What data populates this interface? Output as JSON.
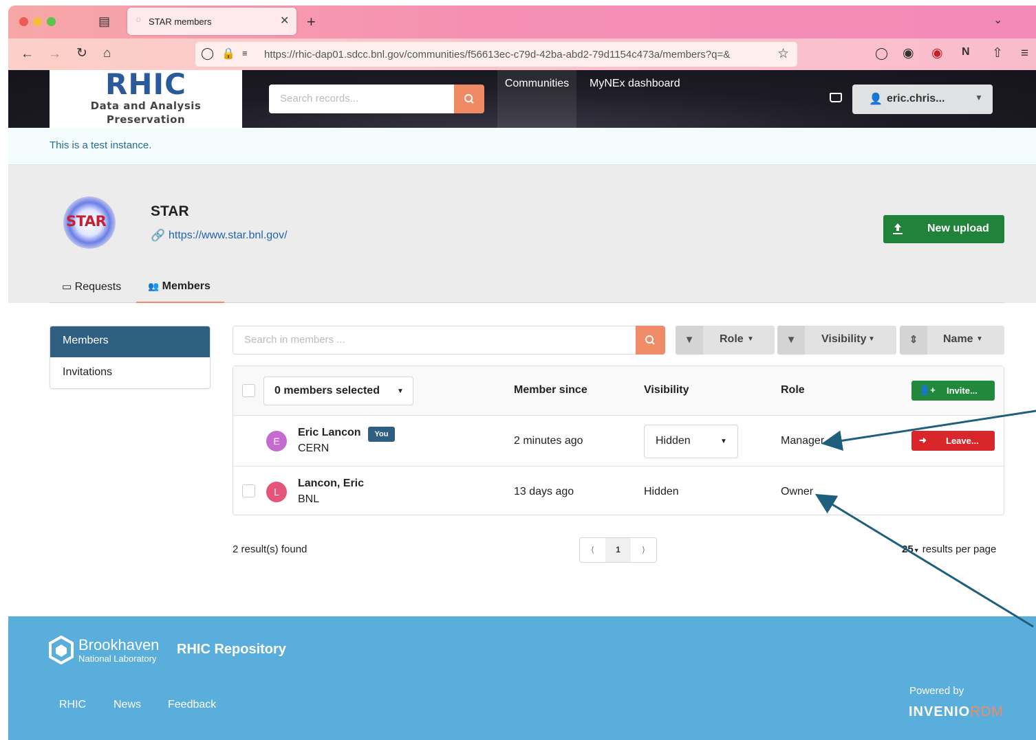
{
  "browser": {
    "tab_title": "STAR members",
    "url": "https://rhic-dap01.sdcc.bnl.gov/communities/f56613ec-c79d-42ba-abd2-79d1154c473a/members?q=&"
  },
  "site": {
    "logo_title": "RHIC",
    "logo_line1": "Data and Analysis",
    "logo_line2": "Preservation",
    "search_placeholder": "Search records...",
    "nav_communities": "Communities",
    "nav_mynex": "MyNEx dashboard",
    "user_label": "eric.chris..."
  },
  "banner": "This is a test instance.",
  "community": {
    "logo_text": "STAR",
    "title": "STAR",
    "link": "https://www.star.bnl.gov/",
    "new_upload": "New upload",
    "tabs": [
      {
        "label": "Requests",
        "active": false
      },
      {
        "label": "Members",
        "active": true
      }
    ]
  },
  "sidebar": {
    "items": [
      {
        "label": "Members",
        "active": true
      },
      {
        "label": "Invitations",
        "active": false
      }
    ]
  },
  "members_search": {
    "placeholder": "Search in members ..."
  },
  "filters": {
    "role": "Role",
    "visibility": "Visibility",
    "sort": "Name"
  },
  "table": {
    "selected": "0 members selected",
    "headers": {
      "since": "Member since",
      "visibility": "Visibility",
      "role": "Role"
    },
    "invite": "Invite...",
    "rows": [
      {
        "initial": "E",
        "name": "Eric Lancon",
        "you": "You",
        "org": "CERN",
        "since": "2 minutes ago",
        "visibility": "Hidden",
        "role": "Manager",
        "action": "Leave...",
        "avatar_color": "#c56bd0"
      },
      {
        "initial": "L",
        "name": "Lancon, Eric",
        "org": "BNL",
        "since": "13 days ago",
        "visibility": "Hidden",
        "role": "Owner",
        "avatar_color": "#e5557a"
      }
    ]
  },
  "results": {
    "found": "2 result(s) found",
    "page": "1",
    "per_page": "25",
    "per_page_label": "results per page"
  },
  "footer": {
    "org_name": "Brookhaven",
    "org_sub": "National Laboratory",
    "repo": "RHIC Repository",
    "links": [
      "RHIC",
      "News",
      "Feedback"
    ],
    "powered": "Powered by",
    "invenio_a": "INVENIO",
    "invenio_b": "RDM"
  },
  "colors": {
    "primary": "#2f5f80",
    "success": "#21823a",
    "danger": "#d9262b",
    "accent": "#ef8b67",
    "footer": "#5aaedb"
  }
}
